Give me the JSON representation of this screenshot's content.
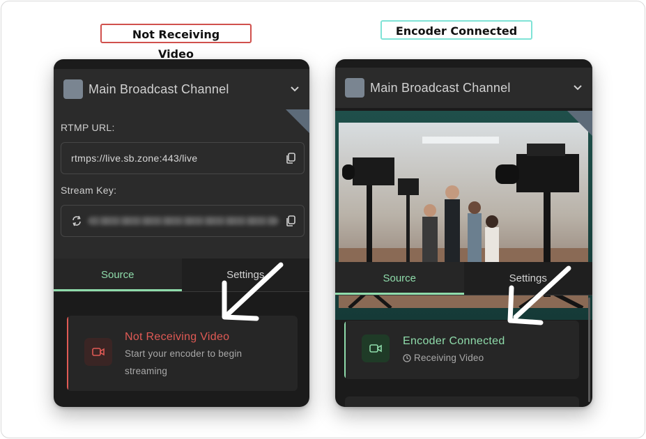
{
  "captions": {
    "left": "Not Receiving Video",
    "right": "Encoder Connected"
  },
  "colors": {
    "error": "#e05a55",
    "success": "#8fdcab",
    "panel_bg": "#1b1b1b"
  },
  "left_panel": {
    "channel_title": "Main Broadcast Channel",
    "rtmp_label": "RTMP URL:",
    "rtmp_value": "rtmps://live.sb.zone:443/live",
    "stream_key_label": "Stream Key:",
    "tabs": [
      {
        "label": "Source",
        "active": true
      },
      {
        "label": "Settings",
        "active": false
      }
    ],
    "status": {
      "title": "Not Receiving Video",
      "line1": "Start your encoder to begin",
      "line2": "streaming"
    }
  },
  "right_panel": {
    "channel_title": "Main Broadcast Channel",
    "tabs": [
      {
        "label": "Source",
        "active": true
      },
      {
        "label": "Settings",
        "active": false
      }
    ],
    "status": {
      "title": "Encoder Connected",
      "subtitle": "Receiving Video"
    }
  },
  "icons": {
    "chevron": "chevron-down-icon",
    "copy": "copy-icon",
    "refresh": "refresh-icon",
    "video": "video-camera-icon",
    "clock": "clock-icon"
  }
}
